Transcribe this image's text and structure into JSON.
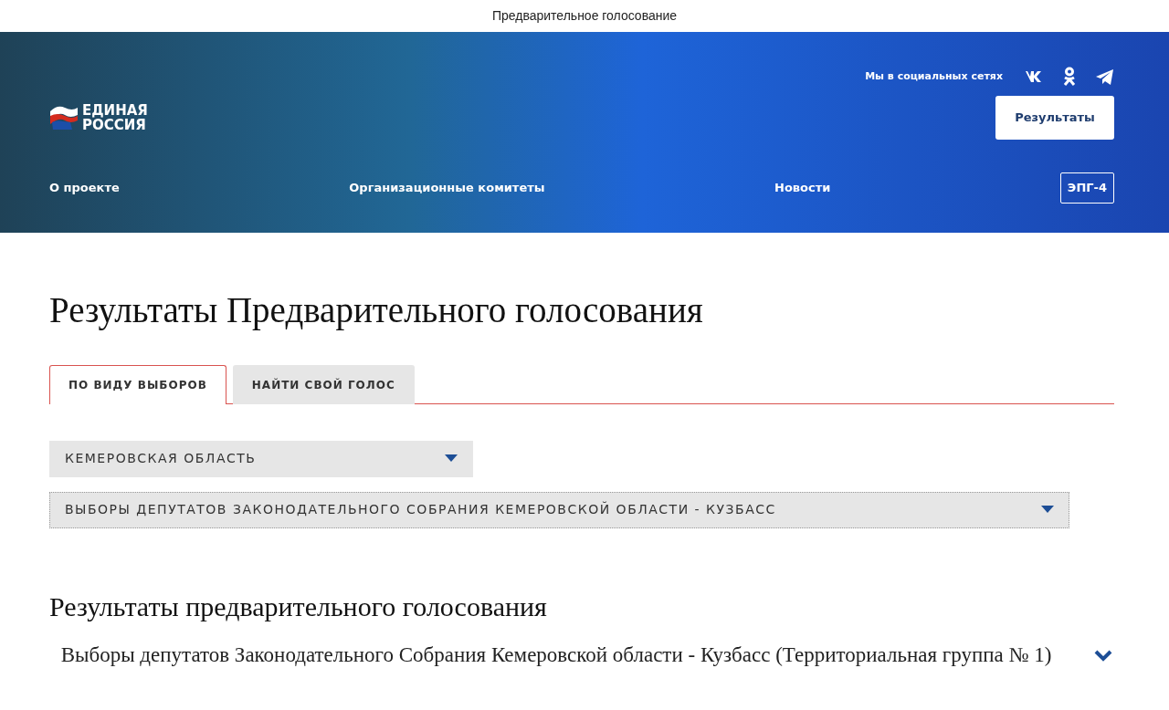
{
  "window": {
    "title": "Предварительное голосование"
  },
  "header": {
    "logo_text": [
      "ЕДИНАЯ",
      "РОССИЯ"
    ],
    "social_label": "Мы в социальных сетях",
    "socials": [
      {
        "kind": "vk"
      },
      {
        "kind": "ok"
      },
      {
        "kind": "telegram"
      }
    ],
    "results_button": "Результаты",
    "nav": [
      {
        "label": "О проекте",
        "kind": "link"
      },
      {
        "label": "Организационные комитеты",
        "kind": "link"
      },
      {
        "label": "Новости",
        "kind": "link"
      },
      {
        "label": "ЭПГ-4",
        "kind": "outlined"
      }
    ]
  },
  "page_title": "Результаты Предварительного голосования",
  "tabs": [
    {
      "label": "ПО ВИДУ ВЫБОРОВ",
      "selected": true
    },
    {
      "label": "НАЙТИ СВОЙ ГОЛОС",
      "selected": false
    }
  ],
  "selects": [
    {
      "value": "КЕМЕРОВСКАЯ ОБЛАСТЬ",
      "focused": false,
      "wide": false
    },
    {
      "value": "ВЫБОРЫ ДЕПУТАТОВ ЗАКОНОДАТЕЛЬНОГО СОБРАНИЯ КЕМЕРОВСКОЙ ОБЛАСТИ - КУЗБАСС",
      "focused": true,
      "wide": true
    }
  ],
  "results": {
    "title": "Результаты предварительного голосования",
    "items": [
      {
        "label": "Выборы депутатов Законодательного Собрания Кемеровской области - Кузбасс (Территориальная группа № 1)",
        "expanded": false
      }
    ]
  }
}
